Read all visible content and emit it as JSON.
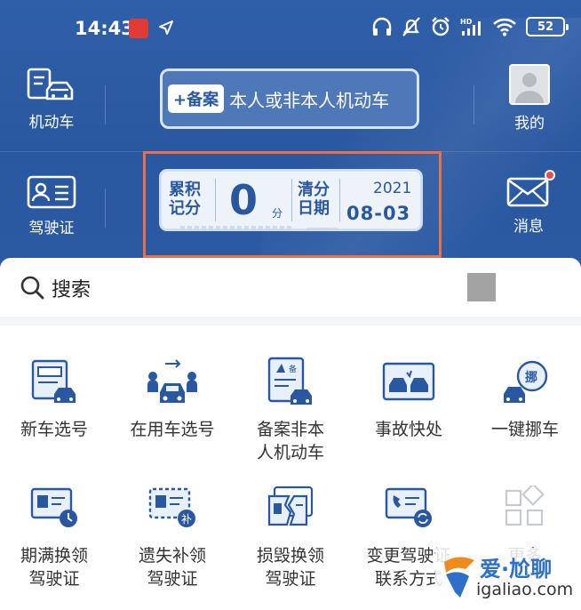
{
  "status_bar": {
    "time": "14:43",
    "battery": "52"
  },
  "header": {
    "vehicle_label": "机动车",
    "license_label": "驾驶证",
    "mine_label": "我的",
    "messages_label": "消息",
    "record_tag": "+备案",
    "record_text": "本人或非本人机动车"
  },
  "points_card": {
    "accumulated_line1": "累积",
    "accumulated_line2": "记分",
    "points": "0",
    "unit": "分",
    "clear_line1": "清分",
    "clear_line2": "日期",
    "year": "2021",
    "date": "08-03"
  },
  "search": {
    "label": "搜索"
  },
  "services": [
    {
      "label": "新车选号",
      "icon": "new-car-plate-icon"
    },
    {
      "label": "在用车选号",
      "icon": "used-car-plate-icon"
    },
    {
      "label": "备案非本\n人机动车",
      "icon": "record-vehicle-icon"
    },
    {
      "label": "事故快处",
      "icon": "accident-icon"
    },
    {
      "label": "一键挪车",
      "icon": "move-car-icon"
    },
    {
      "label": "期满换领\n驾驶证",
      "icon": "expiry-renewal-icon"
    },
    {
      "label": "遗失补领\n驾驶证",
      "icon": "lost-replacement-icon"
    },
    {
      "label": "损毁换领\n驾驶证",
      "icon": "damaged-replacement-icon"
    },
    {
      "label": "变更驾驶证\n联系方式",
      "icon": "change-contact-icon"
    },
    {
      "label": "更多",
      "icon": "more-icon"
    }
  ],
  "watermark": {
    "title": "爱·尬聊",
    "site": "igaliao.com"
  },
  "colors": {
    "primary": "#2a58a0",
    "highlight": "#ec6f45",
    "accent": "#2e6fc9"
  }
}
